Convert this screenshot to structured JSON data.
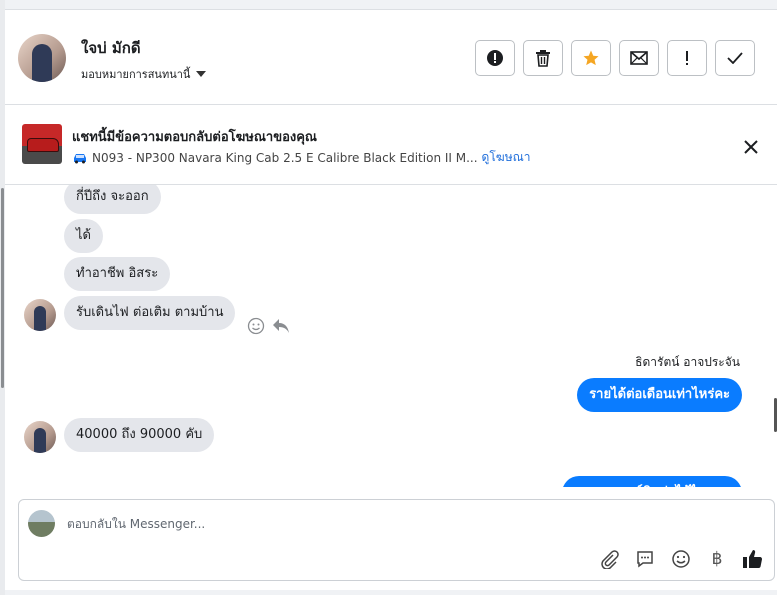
{
  "header": {
    "contact_name": "ใจบ่ มักดี",
    "assign_label": "มอบหมายการสนทนานี้"
  },
  "banner": {
    "title": "แชทนี้มีข้อความตอบกลับต่อโฆษณาของคุณ",
    "ad_text": "N093 - NP300 Navara King Cab 2.5 E Calibre Black Edition II M...",
    "ad_link": "ดูโฆษณา"
  },
  "messages": [
    {
      "dir": "in",
      "text": "กี่ปีถึง จะออก"
    },
    {
      "dir": "in",
      "text": "ได้"
    },
    {
      "dir": "in",
      "text": "ทำอาชีพ อิสระ"
    },
    {
      "dir": "in",
      "text": "รับเดินไฟ ต่อเติม ตามบ้าน"
    },
    {
      "dir": "out",
      "sender": "ธิดารัตน์ อาจประจัน",
      "text": "รายได้ต่อเดือนเท่าไหร่คะ"
    },
    {
      "dir": "in",
      "text": "40000 ถึง 90000 คับ"
    },
    {
      "dir": "out",
      "text": "แอดขอเบอร์ติดต่อได้ไหมคะ"
    }
  ],
  "composer": {
    "placeholder": "ตอบกลับใน Messenger..."
  },
  "colors": {
    "outgoing_bubble": "#0a7cff",
    "incoming_bubble": "#e4e6eb",
    "link": "#216fdb",
    "star": "#f5a623"
  }
}
